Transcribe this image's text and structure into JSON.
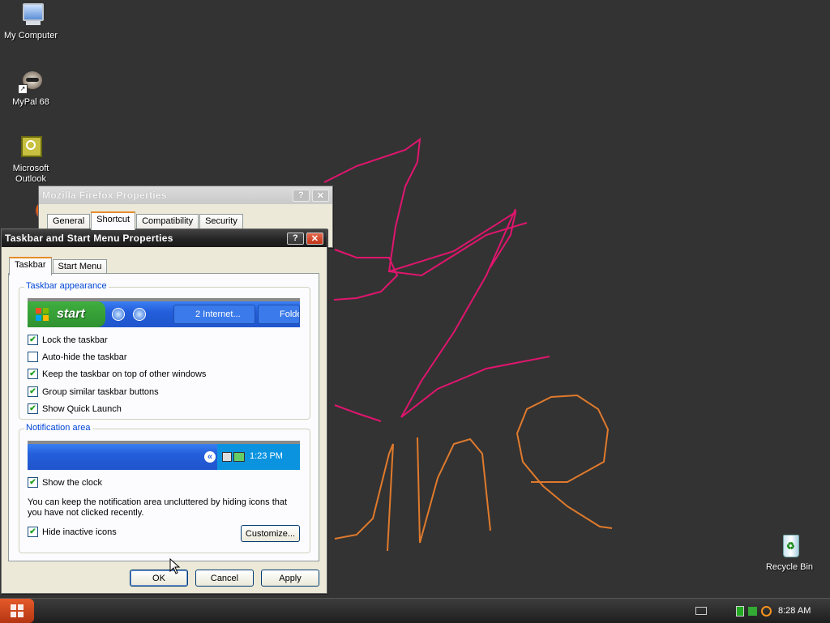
{
  "desktop": {
    "icons": [
      {
        "label": "My Computer"
      },
      {
        "label": "MyPal 68"
      },
      {
        "label": "Microsoft Outlook"
      },
      {
        "label": "Recycle Bin"
      }
    ]
  },
  "firefox_props": {
    "title": "Mozilla Firefox Properties",
    "help": "?",
    "close": "✕",
    "tabs": [
      "General",
      "Shortcut",
      "Compatibility",
      "Security"
    ]
  },
  "taskbar_props": {
    "title": "Taskbar and Start Menu Properties",
    "help": "?",
    "close": "✕",
    "tabs": [
      "Taskbar",
      "Start Menu"
    ],
    "appearance": {
      "label": "Taskbar appearance",
      "preview": {
        "start": "start",
        "item1": "2 Internet...",
        "item2": "Folde"
      },
      "options": [
        {
          "label": "Lock the taskbar",
          "checked": true
        },
        {
          "label": "Auto-hide the taskbar",
          "checked": false
        },
        {
          "label": "Keep the taskbar on top of other windows",
          "checked": true
        },
        {
          "label": "Group similar taskbar buttons",
          "checked": true
        },
        {
          "label": "Show Quick Launch",
          "checked": true
        }
      ]
    },
    "notification": {
      "label": "Notification area",
      "preview_time": "1:23 PM",
      "show_clock": {
        "label": "Show the clock",
        "checked": true
      },
      "description": "You can keep the notification area uncluttered by hiding icons that you have not clicked recently.",
      "hide_inactive": {
        "label": "Hide inactive icons",
        "checked": true
      },
      "customize": "Customize..."
    },
    "buttons": {
      "ok": "OK",
      "cancel": "Cancel",
      "apply": "Apply"
    }
  },
  "taskbar": {
    "clock": "8:28 AM"
  },
  "colors": {
    "desktop": "#333333",
    "scribble_pink": "#e0156e",
    "scribble_orange": "#e07a2c"
  }
}
